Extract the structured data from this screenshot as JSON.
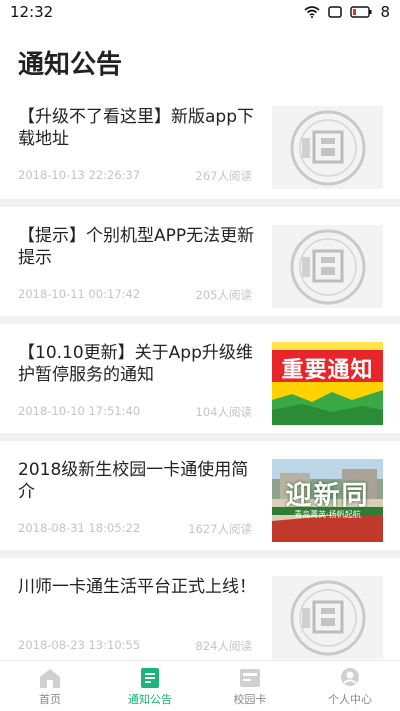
{
  "status": {
    "time": "12:32",
    "battery": "8"
  },
  "page": {
    "title": "通知公告"
  },
  "news": [
    {
      "title": "【升级不了看这里】新版app下载地址",
      "date": "2018-10-13 22:26:37",
      "reads": "267人阅读",
      "thumb": "school-seal"
    },
    {
      "title": "【提示】个别机型APP无法更新提示",
      "date": "2018-10-11 00:17:42",
      "reads": "205人阅读",
      "thumb": "school-seal"
    },
    {
      "title": "【10.10更新】关于App升级维护暂停服务的通知",
      "date": "2018-10-10 17:51:40",
      "reads": "104人阅读",
      "thumb": "important-notice-banner",
      "thumb_text": "重要通知"
    },
    {
      "title": "2018级新生校园一卡通使用简介",
      "date": "2018-08-31 18:05:22",
      "reads": "1627人阅读",
      "thumb": "welcome-freshmen-photo",
      "thumb_text": "迎新同",
      "thumb_subtext": "青岛菁英·扬帆起航"
    },
    {
      "title": "川师一卡通生活平台正式上线！",
      "date": "2018-08-23 13:10:55",
      "reads": "824人阅读",
      "thumb": "school-seal"
    }
  ],
  "tabs": [
    {
      "label": "首页",
      "icon": "home-icon",
      "active": false
    },
    {
      "label": "通知公告",
      "icon": "notice-icon",
      "active": true
    },
    {
      "label": "校园卡",
      "icon": "card-icon",
      "active": false
    },
    {
      "label": "个人中心",
      "icon": "user-icon",
      "active": false
    }
  ],
  "colors": {
    "accent": "#1bb47a",
    "banner_red": "#e8262a",
    "banner_yellow": "#ffd200"
  }
}
